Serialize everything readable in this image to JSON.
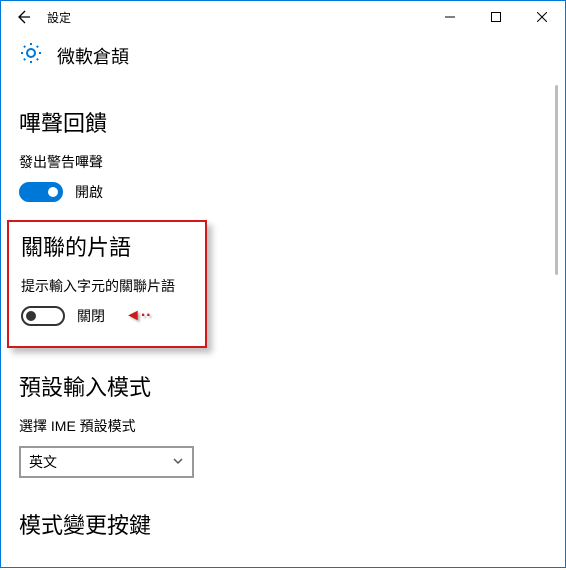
{
  "window": {
    "title": "設定"
  },
  "header": {
    "page_title": "微軟倉頡"
  },
  "sections": {
    "beep": {
      "title": "嗶聲回饋",
      "label": "發出警告嗶聲",
      "state": "開啟"
    },
    "assoc": {
      "title": "關聯的片語",
      "label": "提示輸入字元的關聯片語",
      "state": "關閉"
    },
    "default_mode": {
      "title": "預設輸入模式",
      "label": "選擇 IME 預設模式",
      "value": "英文"
    },
    "mode_key": {
      "title": "模式變更按鍵"
    }
  },
  "colors": {
    "accent": "#0078d7",
    "highlight": "#d11919"
  }
}
